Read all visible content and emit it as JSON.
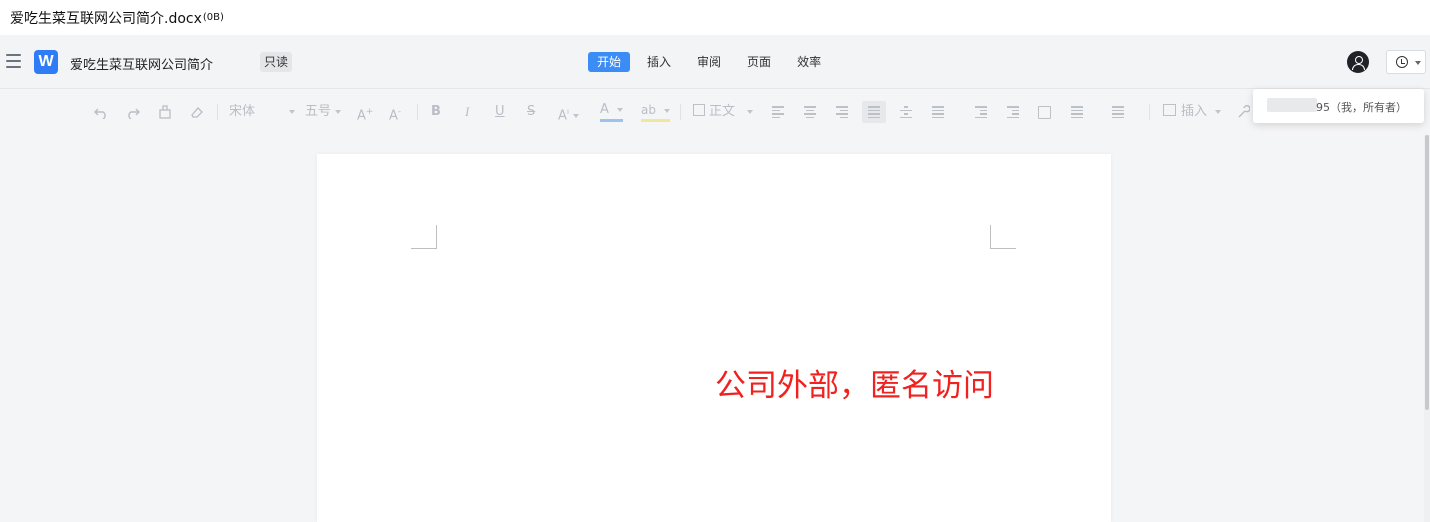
{
  "window": {
    "file_name": "爱吃生菜互联网公司简介.docx",
    "file_size": "(0B)"
  },
  "appbar": {
    "logo_letter": "W",
    "doc_title": "爱吃生菜互联网公司简介",
    "mode_badge": "只读",
    "tabs": [
      {
        "label": "开始",
        "active": true
      },
      {
        "label": "插入",
        "active": false
      },
      {
        "label": "审阅",
        "active": false
      },
      {
        "label": "页面",
        "active": false
      },
      {
        "label": "效率",
        "active": false
      }
    ]
  },
  "toolbar": {
    "font_name": "宋体",
    "font_size": "五号",
    "bold": "B",
    "italic": "I",
    "underline": "U",
    "strike": "S",
    "font_color": "A",
    "highlight": "ab",
    "style_name": "正文",
    "insert_label": "插入"
  },
  "popup": {
    "text": "95（我，所有者）"
  },
  "document": {
    "overlay_text": "公司外部，匿名访问"
  },
  "colors": {
    "accent": "#3c8cf5",
    "logo": "#2f7cf6",
    "overlay_text": "#f0211f"
  }
}
